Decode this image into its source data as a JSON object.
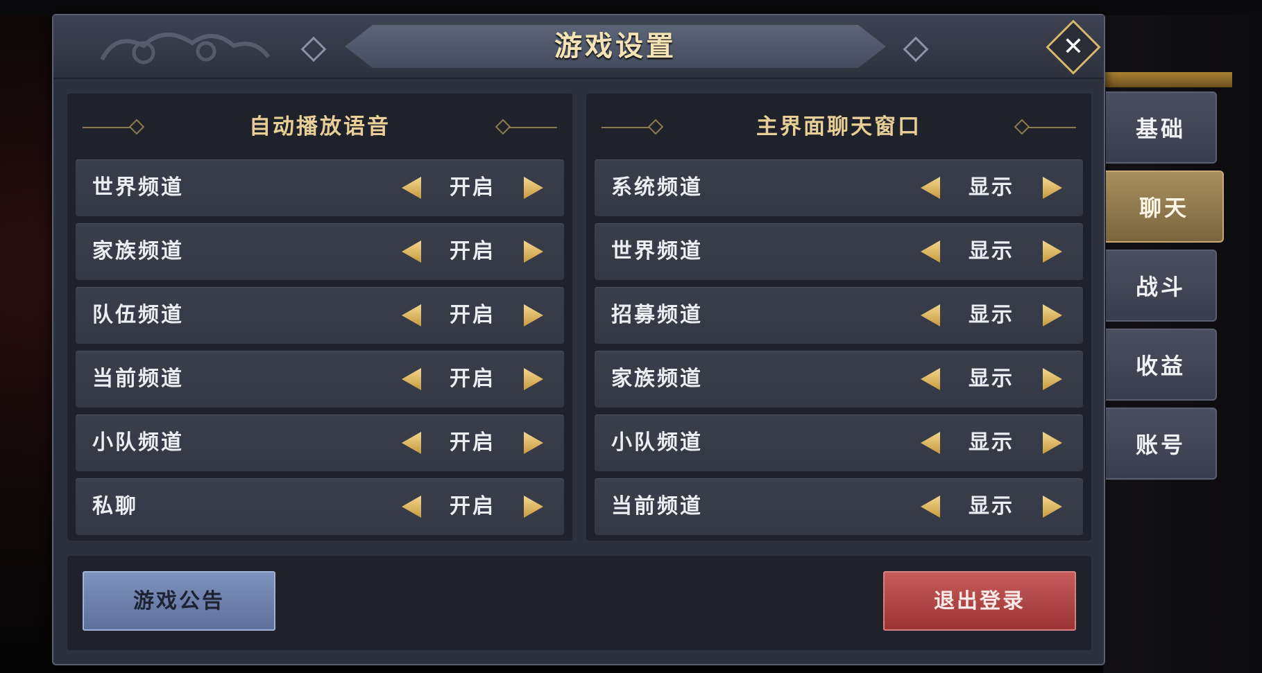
{
  "window": {
    "title": "游戏设置"
  },
  "left_panel": {
    "title": "自动播放语音",
    "rows": [
      {
        "label": "世界频道",
        "value": "开启"
      },
      {
        "label": "家族频道",
        "value": "开启"
      },
      {
        "label": "队伍频道",
        "value": "开启"
      },
      {
        "label": "当前频道",
        "value": "开启"
      },
      {
        "label": "小队频道",
        "value": "开启"
      },
      {
        "label": "私聊",
        "value": "开启"
      }
    ]
  },
  "right_panel": {
    "title": "主界面聊天窗口",
    "rows": [
      {
        "label": "系统频道",
        "value": "显示"
      },
      {
        "label": "世界频道",
        "value": "显示"
      },
      {
        "label": "招募频道",
        "value": "显示"
      },
      {
        "label": "家族频道",
        "value": "显示"
      },
      {
        "label": "小队频道",
        "value": "显示"
      },
      {
        "label": "当前频道",
        "value": "显示"
      }
    ]
  },
  "bottom": {
    "notice_label": "游戏公告",
    "logout_label": "退出登录"
  },
  "tabs": [
    {
      "label": "基础",
      "active": false
    },
    {
      "label": "聊天",
      "active": true
    },
    {
      "label": "战斗",
      "active": false
    },
    {
      "label": "收益",
      "active": false
    },
    {
      "label": "账号",
      "active": false
    }
  ],
  "icons": {
    "close": "close-icon",
    "left_arrow": "triangle-left-icon",
    "right_arrow": "triangle-right-icon"
  },
  "colors": {
    "accent_gold": "#e7cf97",
    "notice_button": "#6f84b0",
    "logout_button": "#b44848",
    "active_tab": "#a88f5e"
  }
}
